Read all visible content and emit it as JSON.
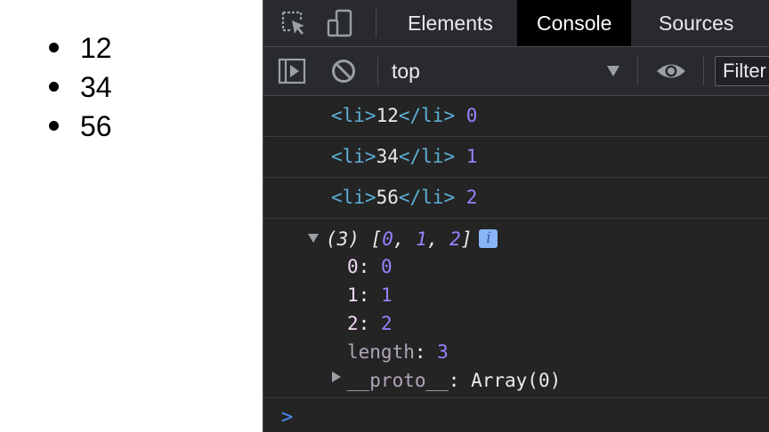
{
  "page": {
    "list_items": [
      "12",
      "34",
      "56"
    ]
  },
  "devtools": {
    "toolbar_icons": [
      "inspect-element-icon",
      "device-toggle-icon"
    ],
    "tabs": [
      {
        "label": "Elements",
        "active": false
      },
      {
        "label": "Console",
        "active": true
      },
      {
        "label": "Sources",
        "active": false
      }
    ],
    "console_toolbar": {
      "sidebar_icon": "sidebar-toggle-icon",
      "clear_icon": "clear-console-icon",
      "context": "top",
      "eye_icon": "live-expression-icon",
      "filter_placeholder": "Filter"
    },
    "messages": [
      {
        "open_tag": "<li>",
        "text": "12",
        "close_tag": "</li>",
        "index": "0"
      },
      {
        "open_tag": "<li>",
        "text": "34",
        "close_tag": "</li>",
        "index": "1"
      },
      {
        "open_tag": "<li>",
        "text": "56",
        "close_tag": "</li>",
        "index": "2"
      }
    ],
    "array_log": {
      "count": "(3)",
      "open_bracket": "[",
      "items": [
        "0",
        "1",
        "2"
      ],
      "close_bracket": "]",
      "info_glyph": "i",
      "properties": [
        {
          "key": "0",
          "value": "0"
        },
        {
          "key": "1",
          "value": "1"
        },
        {
          "key": "2",
          "value": "2"
        },
        {
          "key": "length",
          "value": "3"
        }
      ],
      "proto_key": "__proto__",
      "proto_value": "Array(0)"
    },
    "prompt_symbol": ">"
  },
  "colors": {
    "tag": "#5db0d7",
    "number": "#9980ff",
    "key": "#f2d7f5",
    "prompt": "#4d90fe",
    "panel_bg": "#242424"
  }
}
